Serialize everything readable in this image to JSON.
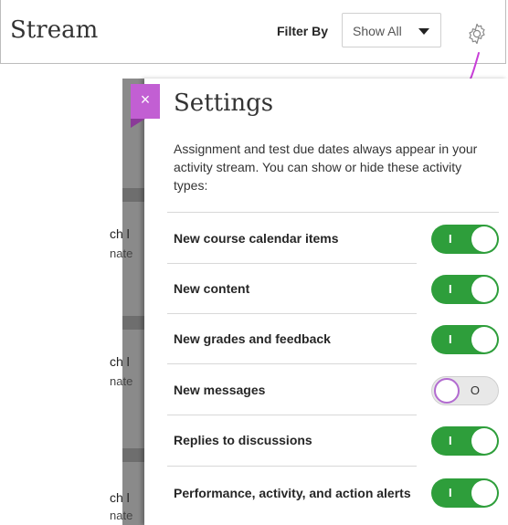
{
  "header": {
    "title": "Stream",
    "filter_label": "Filter By",
    "filter_value": "Show All"
  },
  "background": {
    "snippets": [
      {
        "line1": "ch l",
        "line2": "nate"
      },
      {
        "line1": "ch l",
        "line2": "nate"
      },
      {
        "line1": "ch l",
        "line2": "nate"
      }
    ]
  },
  "settings": {
    "close_label": "×",
    "title": "Settings",
    "description": "Assignment and test due dates always appear in your activity stream. You can show or hide these activity types:",
    "rows": [
      {
        "label": "New course calendar items",
        "enabled": true,
        "mark": "I"
      },
      {
        "label": "New content",
        "enabled": true,
        "mark": "I"
      },
      {
        "label": "New grades and feedback",
        "enabled": true,
        "mark": "I"
      },
      {
        "label": "New messages",
        "enabled": false,
        "mark": "O"
      },
      {
        "label": "Replies to discussions",
        "enabled": true,
        "mark": "I"
      },
      {
        "label": "Performance, activity, and action alerts",
        "enabled": true,
        "mark": "I"
      }
    ]
  },
  "colors": {
    "accent": "#c25fd3",
    "toggle_on": "#2e9e3b",
    "annotation": "#c83fd8"
  }
}
